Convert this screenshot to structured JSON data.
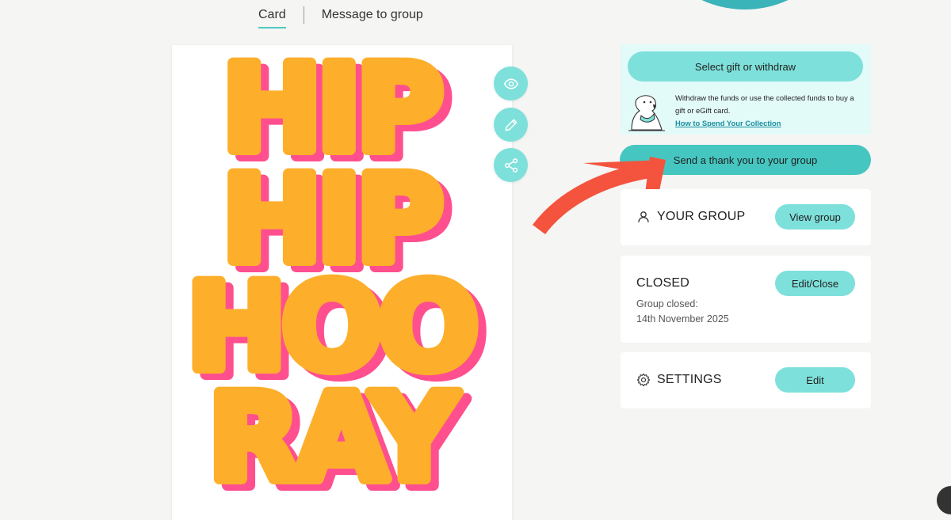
{
  "tabs": [
    {
      "label": "Card",
      "active": true
    },
    {
      "label": "Message to group",
      "active": false
    }
  ],
  "card": {
    "lines": [
      "HIP",
      "HIP",
      "HOO",
      "RAY"
    ],
    "colors": {
      "fill": "#fdaf2b",
      "shadow": "#ff4f8e"
    }
  },
  "card_actions": [
    {
      "name": "eye-icon",
      "purpose": "preview"
    },
    {
      "name": "pencil-icon",
      "purpose": "edit"
    },
    {
      "name": "share-icon",
      "purpose": "share"
    }
  ],
  "gift": {
    "button_label": "Select gift or withdraw",
    "description": "Withdraw the funds or use the collected funds to buy a gift or eGift card.",
    "link_label": "How to Spend Your Collection",
    "illustration_icon": "dog-illustration"
  },
  "thanks_button_label": "Send a thank you to your group",
  "group_panel": {
    "icon": "user-icon",
    "title": "YOUR GROUP",
    "button_label": "View group"
  },
  "status_panel": {
    "title": "CLOSED",
    "closed_label": "Group closed:",
    "closed_date": "14th November 2025",
    "button_label": "Edit/Close"
  },
  "settings_panel": {
    "icon": "gear-icon",
    "title": "SETTINGS",
    "button_label": "Edit"
  },
  "colors": {
    "accent": "#7ee0da",
    "accent_dark": "#45c6c0",
    "arrow": "#f4533d",
    "ring": "#3ab3b9"
  }
}
